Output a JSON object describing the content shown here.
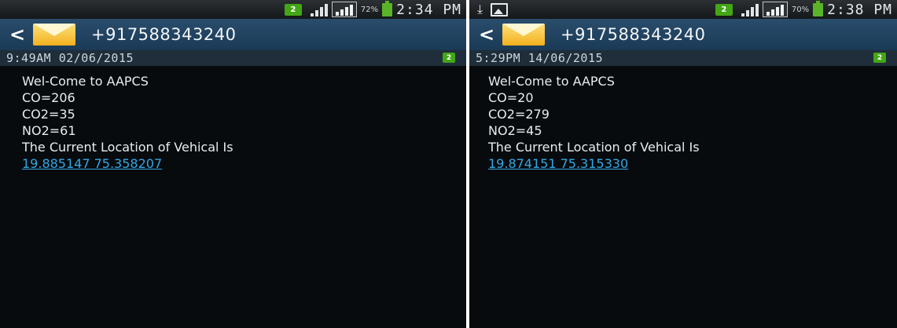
{
  "left": {
    "status": {
      "sim_badge": "2",
      "battery_pct": "72%",
      "time": "2:34 PM"
    },
    "thread": {
      "back_glyph": "<",
      "number": "+917588343240"
    },
    "message": {
      "date": "9:49AM 02/06/2015",
      "sim_badge": "2",
      "lines": [
        "Wel-Come to AAPCS",
        "CO=206",
        "CO2=35",
        "NO2=61",
        "The Current Location of Vehical Is"
      ],
      "link": "19.885147 75.358207"
    }
  },
  "right": {
    "status": {
      "sim_badge": "2",
      "battery_pct": "70%",
      "time": "2:38 PM"
    },
    "thread": {
      "back_glyph": "<",
      "number": "+917588343240"
    },
    "message": {
      "date": "5:29PM 14/06/2015",
      "sim_badge": "2",
      "lines": [
        "Wel-Come to AAPCS",
        "CO=20",
        "CO2=279",
        "NO2=45",
        "The Current Location of Vehical Is"
      ],
      "link": "19.874151 75.315330"
    }
  },
  "colors": {
    "accent_green": "#43a615",
    "link": "#33a8e6",
    "titlebar": "#214462"
  },
  "icons": [
    "sim-badge-icon",
    "roaming-signal-icon",
    "signal-icon",
    "battery-icon",
    "download-icon",
    "image-icon",
    "back-icon",
    "envelope-icon"
  ]
}
